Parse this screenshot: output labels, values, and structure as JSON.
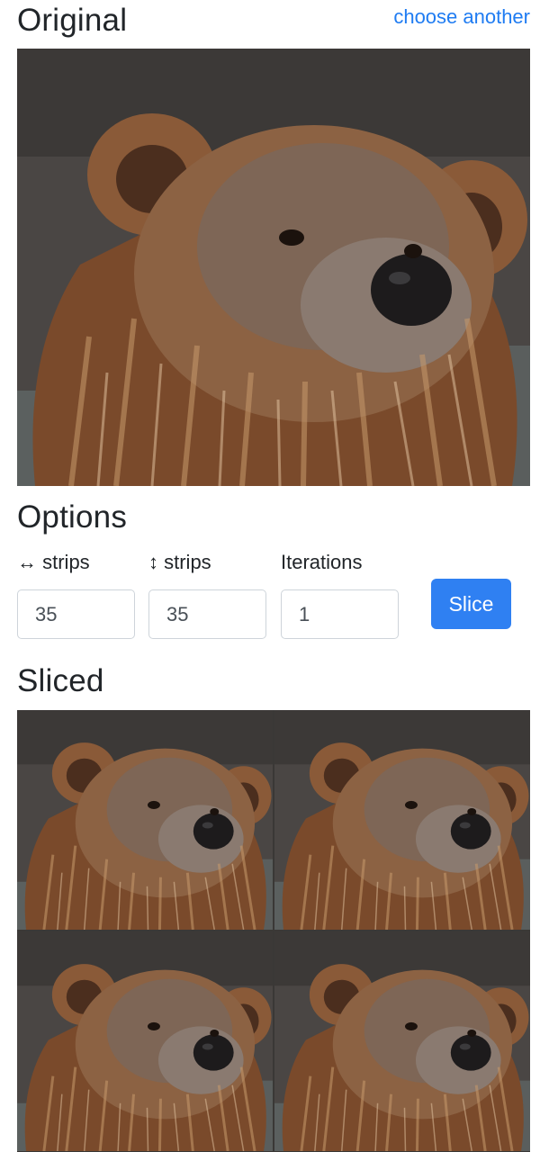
{
  "original": {
    "title": "Original",
    "choose_another_label": "choose another",
    "photo_icon": "bear-photo"
  },
  "options": {
    "title": "Options",
    "horizontal_strips": {
      "label": "↔ strips",
      "value": "35"
    },
    "vertical_strips": {
      "label": "↕ strips",
      "value": "35"
    },
    "iterations": {
      "label": "Iterations",
      "value": "1"
    },
    "slice_label": "Slice"
  },
  "sliced": {
    "title": "Sliced",
    "tile_count": 4
  },
  "colors": {
    "accent": "#2f80f2",
    "link": "#1f7cf2",
    "text": "#212529"
  }
}
